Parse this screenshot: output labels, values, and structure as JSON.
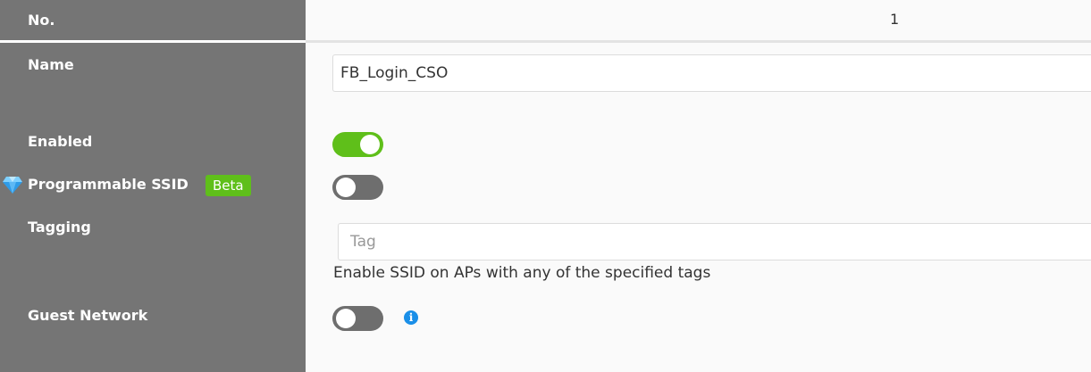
{
  "labels": {
    "no": "No.",
    "name": "Name",
    "enabled": "Enabled",
    "programmable_ssid": "Programmable SSID",
    "tagging": "Tagging",
    "guest_network": "Guest Network"
  },
  "beta_badge": "Beta",
  "values": {
    "no": "1",
    "name": "FB_Login_CSO",
    "tag_placeholder": "Tag",
    "tag_hint": "Enable SSID on APs with any of the specified tags",
    "enabled": true,
    "programmable_ssid": false,
    "guest_network": false
  },
  "icons": {
    "gem": "gem-icon",
    "info": "info-icon"
  },
  "colors": {
    "toggle_on": "#5fbf1a",
    "toggle_off": "#6e6e6e",
    "label_column": "#757575",
    "info": "#1a8fe8"
  }
}
